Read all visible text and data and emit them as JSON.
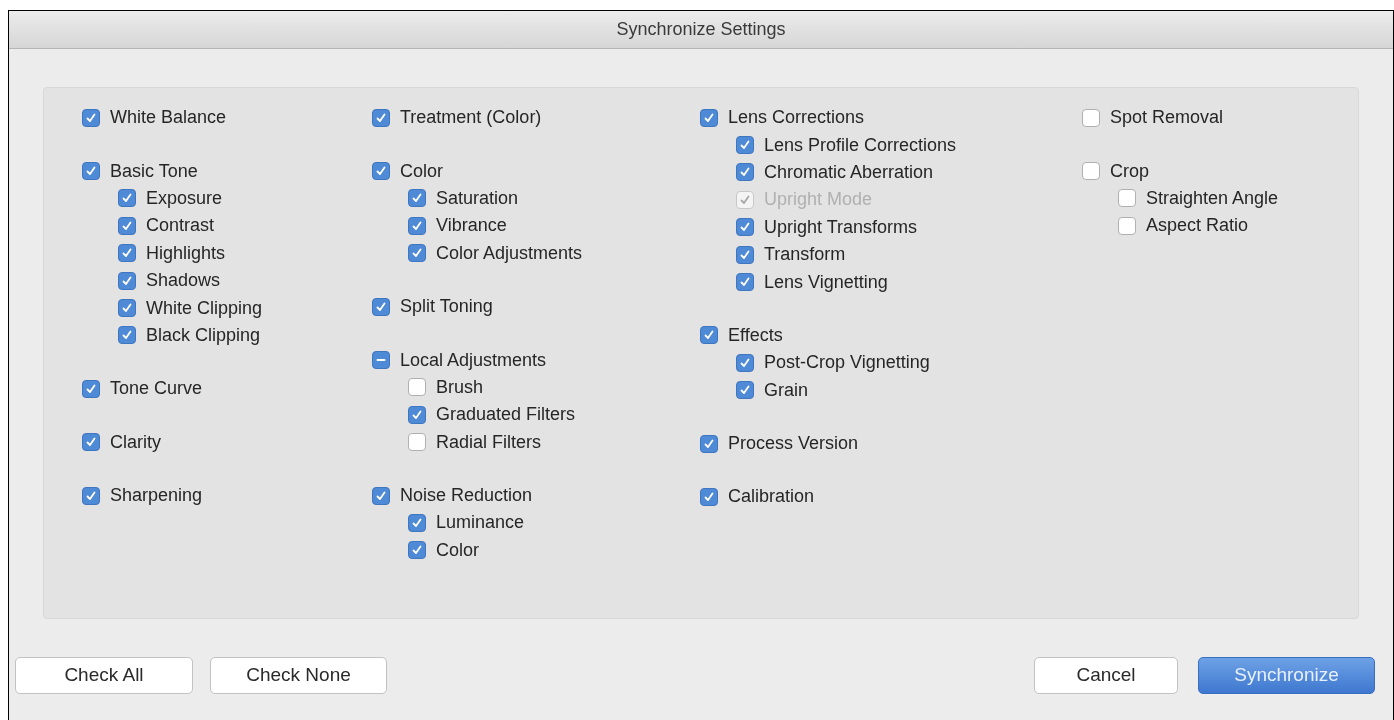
{
  "window": {
    "title": "Synchronize Settings"
  },
  "columns": [
    {
      "groups": [
        {
          "label": "White Balance",
          "checked": true,
          "disabled": false
        },
        {
          "label": "Basic Tone",
          "checked": true,
          "disabled": false,
          "children": [
            {
              "label": "Exposure",
              "checked": true,
              "disabled": false
            },
            {
              "label": "Contrast",
              "checked": true,
              "disabled": false
            },
            {
              "label": "Highlights",
              "checked": true,
              "disabled": false
            },
            {
              "label": "Shadows",
              "checked": true,
              "disabled": false
            },
            {
              "label": "White Clipping",
              "checked": true,
              "disabled": false
            },
            {
              "label": "Black Clipping",
              "checked": true,
              "disabled": false
            }
          ]
        },
        {
          "label": "Tone Curve",
          "checked": true,
          "disabled": false
        },
        {
          "label": "Clarity",
          "checked": true,
          "disabled": false
        },
        {
          "label": "Sharpening",
          "checked": true,
          "disabled": false
        }
      ]
    },
    {
      "groups": [
        {
          "label": "Treatment (Color)",
          "checked": true,
          "disabled": false
        },
        {
          "label": "Color",
          "checked": true,
          "disabled": false,
          "children": [
            {
              "label": "Saturation",
              "checked": true,
              "disabled": false
            },
            {
              "label": "Vibrance",
              "checked": true,
              "disabled": false
            },
            {
              "label": "Color Adjustments",
              "checked": true,
              "disabled": false
            }
          ]
        },
        {
          "label": "Split Toning",
          "checked": true,
          "disabled": false
        },
        {
          "label": "Local Adjustments",
          "checked": true,
          "mixed": true,
          "disabled": false,
          "children": [
            {
              "label": "Brush",
              "checked": false,
              "disabled": false
            },
            {
              "label": "Graduated Filters",
              "checked": true,
              "disabled": false
            },
            {
              "label": "Radial Filters",
              "checked": false,
              "disabled": false
            }
          ]
        },
        {
          "label": "Noise Reduction",
          "checked": true,
          "disabled": false,
          "children": [
            {
              "label": "Luminance",
              "checked": true,
              "disabled": false
            },
            {
              "label": "Color",
              "checked": true,
              "disabled": false
            }
          ]
        }
      ]
    },
    {
      "groups": [
        {
          "label": "Lens Corrections",
          "checked": true,
          "disabled": false,
          "children": [
            {
              "label": "Lens Profile Corrections",
              "checked": true,
              "disabled": false
            },
            {
              "label": "Chromatic Aberration",
              "checked": true,
              "disabled": false
            },
            {
              "label": "Upright Mode",
              "checked": true,
              "disabled": true
            },
            {
              "label": "Upright Transforms",
              "checked": true,
              "disabled": false
            },
            {
              "label": "Transform",
              "checked": true,
              "disabled": false
            },
            {
              "label": "Lens Vignetting",
              "checked": true,
              "disabled": false
            }
          ]
        },
        {
          "label": "Effects",
          "checked": true,
          "disabled": false,
          "children": [
            {
              "label": "Post-Crop Vignetting",
              "checked": true,
              "disabled": false
            },
            {
              "label": "Grain",
              "checked": true,
              "disabled": false
            }
          ]
        },
        {
          "label": "Process Version",
          "checked": true,
          "disabled": false
        },
        {
          "label": "Calibration",
          "checked": true,
          "disabled": false
        }
      ]
    },
    {
      "groups": [
        {
          "label": "Spot Removal",
          "checked": false,
          "disabled": false
        },
        {
          "label": "Crop",
          "checked": false,
          "disabled": false,
          "children": [
            {
              "label": "Straighten Angle",
              "checked": false,
              "disabled": false
            },
            {
              "label": "Aspect Ratio",
              "checked": false,
              "disabled": false
            }
          ]
        }
      ]
    }
  ],
  "left_buttons": [
    {
      "label": "Check All",
      "kind": "plain"
    },
    {
      "label": "Check None",
      "kind": "plain"
    }
  ],
  "right_buttons": [
    {
      "label": "Cancel",
      "kind": "plain"
    },
    {
      "label": "Synchronize",
      "kind": "default"
    }
  ]
}
